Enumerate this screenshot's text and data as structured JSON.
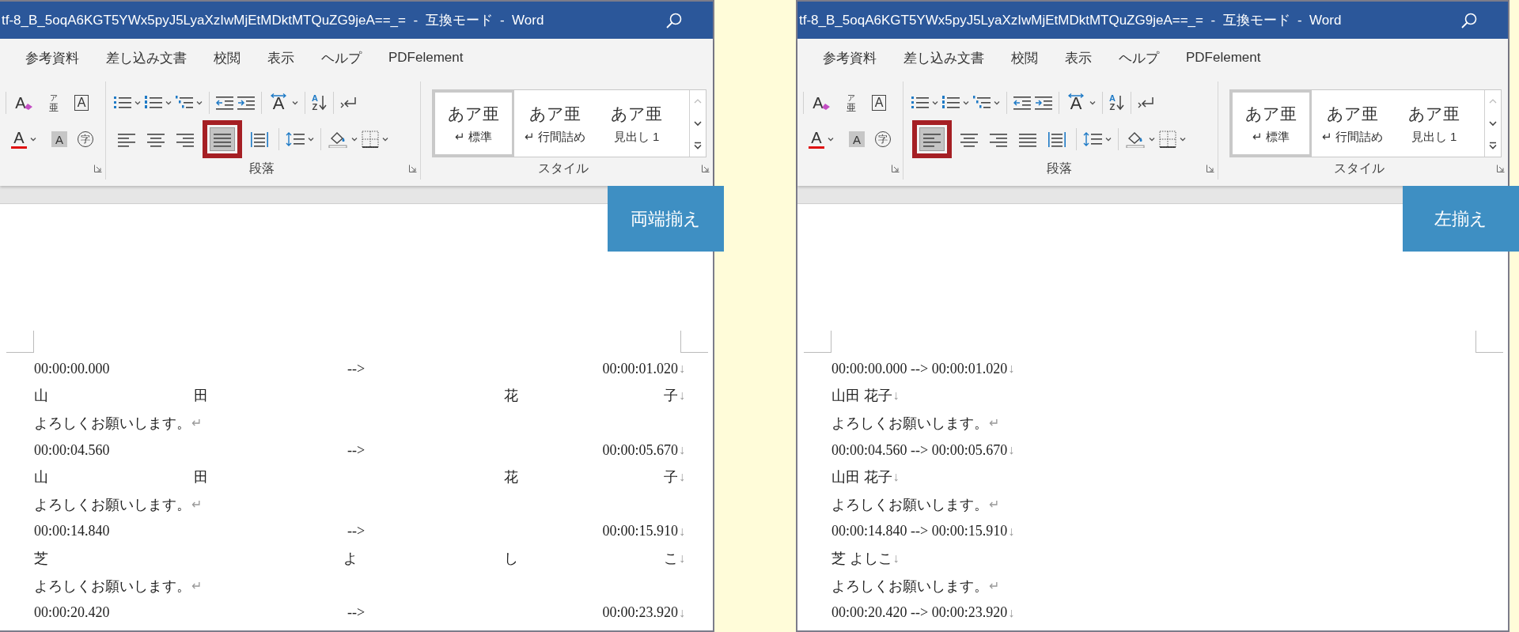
{
  "panels": [
    {
      "title_bar": {
        "title": "tf-8_B_5oqA6KGT5YWx5pyJ5LyaXzIwMjEtMDktMTQuZG9jeA==_=  -  互換モード  -  Word"
      },
      "tabs": [
        "参考資料",
        "差し込み文書",
        "校閲",
        "表示",
        "ヘルプ",
        "PDFelement"
      ],
      "font_tools": {
        "clear_formatting": "A",
        "phonetic_guide_top": "ア",
        "phonetic_guide_bottom": "亜",
        "character_border": "A",
        "font_color": "A",
        "character_shading": "A",
        "enclose_characters": "字"
      },
      "asian_layout": "A",
      "sort": {
        "top": "A",
        "bottom": "Z"
      },
      "alignment_buttons": [
        {
          "kind": "left",
          "selected": false
        },
        {
          "kind": "center",
          "selected": false
        },
        {
          "kind": "right",
          "selected": false
        },
        {
          "kind": "justify",
          "selected": true
        },
        {
          "kind": "distribute",
          "selected": false
        }
      ],
      "paragraph_label": "段落",
      "styles": [
        {
          "sample": "あア亜",
          "name": "↵ 標準",
          "selected": true
        },
        {
          "sample": "あア亜",
          "name": "↵ 行間詰め",
          "selected": false
        },
        {
          "sample": "あア亜",
          "name": "見出し 1",
          "selected": false
        }
      ],
      "styles_label": "スタイル",
      "callout": "両端揃え",
      "lines": [
        {
          "text": "00:00:00.000 --> 00:00:01.020",
          "mark": "↓",
          "kind": "break"
        },
        {
          "text": "山田 花子",
          "mark": "↓",
          "kind": "break"
        },
        {
          "text": "よろしくお願いします。",
          "mark": "↵",
          "kind": "paragraph"
        },
        {
          "text": "00:00:04.560 --> 00:00:05.670",
          "mark": "↓",
          "kind": "break"
        },
        {
          "text": "山田 花子",
          "mark": "↓",
          "kind": "break"
        },
        {
          "text": "よろしくお願いします。",
          "mark": "↵",
          "kind": "paragraph"
        },
        {
          "text": "00:00:14.840 --> 00:00:15.910",
          "mark": "↓",
          "kind": "break"
        },
        {
          "text": "芝 よしこ",
          "mark": "↓",
          "kind": "break"
        },
        {
          "text": "よろしくお願いします。",
          "mark": "↵",
          "kind": "paragraph"
        },
        {
          "text": "00:00:20.420 --> 00:00:23.920",
          "mark": "↓",
          "kind": "break"
        }
      ]
    },
    {
      "title_bar": {
        "title": "tf-8_B_5oqA6KGT5YWx5pyJ5LyaXzIwMjEtMDktMTQuZG9jeA==_=  -  互換モード  -  Word"
      },
      "tabs": [
        "参考資料",
        "差し込み文書",
        "校閲",
        "表示",
        "ヘルプ",
        "PDFelement"
      ],
      "font_tools": {
        "clear_formatting": "A",
        "phonetic_guide_top": "ア",
        "phonetic_guide_bottom": "亜",
        "character_border": "A",
        "font_color": "A",
        "character_shading": "A",
        "enclose_characters": "字"
      },
      "asian_layout": "A",
      "sort": {
        "top": "A",
        "bottom": "Z"
      },
      "alignment_buttons": [
        {
          "kind": "left",
          "selected": true
        },
        {
          "kind": "center",
          "selected": false
        },
        {
          "kind": "right",
          "selected": false
        },
        {
          "kind": "justify",
          "selected": false
        },
        {
          "kind": "distribute",
          "selected": false
        }
      ],
      "paragraph_label": "段落",
      "styles": [
        {
          "sample": "あア亜",
          "name": "↵ 標準",
          "selected": true
        },
        {
          "sample": "あア亜",
          "name": "↵ 行間詰め",
          "selected": false
        },
        {
          "sample": "あア亜",
          "name": "見出し 1",
          "selected": false
        }
      ],
      "styles_label": "スタイル",
      "callout": "左揃え",
      "lines": [
        {
          "text": "00:00:00.000 --> 00:00:01.020",
          "mark": "↓",
          "kind": "break"
        },
        {
          "text": "山田 花子",
          "mark": "↓",
          "kind": "break"
        },
        {
          "text": "よろしくお願いします。",
          "mark": "↵",
          "kind": "paragraph"
        },
        {
          "text": "00:00:04.560 --> 00:00:05.670",
          "mark": "↓",
          "kind": "break"
        },
        {
          "text": "山田 花子",
          "mark": "↓",
          "kind": "break"
        },
        {
          "text": "よろしくお願いします。",
          "mark": "↵",
          "kind": "paragraph"
        },
        {
          "text": "00:00:14.840 --> 00:00:15.910",
          "mark": "↓",
          "kind": "break"
        },
        {
          "text": "芝 よしこ",
          "mark": "↓",
          "kind": "break"
        },
        {
          "text": "よろしくお願いします。",
          "mark": "↵",
          "kind": "paragraph"
        },
        {
          "text": "00:00:20.420 --> 00:00:23.920",
          "mark": "↓",
          "kind": "break"
        }
      ]
    }
  ]
}
